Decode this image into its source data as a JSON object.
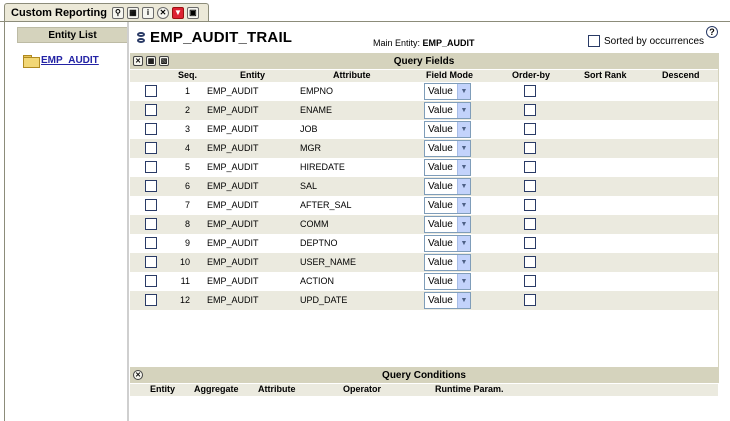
{
  "tab": {
    "title": "Custom Reporting",
    "buttons": [
      "search-icon",
      "save-icon",
      "info-icon",
      "close-icon",
      "down-arrow-icon",
      "window-icon"
    ]
  },
  "left_panel": {
    "header": "Entity List",
    "items": [
      {
        "label": "EMP_AUDIT"
      }
    ]
  },
  "header": {
    "title": "EMP_AUDIT_TRAIL",
    "main_entity_label": "Main Entity:",
    "main_entity_value": "EMP_AUDIT",
    "sorted_label": "Sorted by occurrences",
    "help_glyph": "?"
  },
  "query_fields": {
    "title": "Query Fields",
    "columns": {
      "seq": "Seq.",
      "entity": "Entity",
      "attribute": "Attribute",
      "field_mode": "Field Mode",
      "order_by": "Order-by",
      "sort_rank": "Sort Rank",
      "descend": "Descend"
    },
    "rows": [
      {
        "seq": "1",
        "entity": "EMP_AUDIT",
        "attribute": "EMPNO",
        "mode": "Value"
      },
      {
        "seq": "2",
        "entity": "EMP_AUDIT",
        "attribute": "ENAME",
        "mode": "Value"
      },
      {
        "seq": "3",
        "entity": "EMP_AUDIT",
        "attribute": "JOB",
        "mode": "Value"
      },
      {
        "seq": "4",
        "entity": "EMP_AUDIT",
        "attribute": "MGR",
        "mode": "Value"
      },
      {
        "seq": "5",
        "entity": "EMP_AUDIT",
        "attribute": "HIREDATE",
        "mode": "Value"
      },
      {
        "seq": "6",
        "entity": "EMP_AUDIT",
        "attribute": "SAL",
        "mode": "Value"
      },
      {
        "seq": "7",
        "entity": "EMP_AUDIT",
        "attribute": "AFTER_SAL",
        "mode": "Value"
      },
      {
        "seq": "8",
        "entity": "EMP_AUDIT",
        "attribute": "COMM",
        "mode": "Value"
      },
      {
        "seq": "9",
        "entity": "EMP_AUDIT",
        "attribute": "DEPTNO",
        "mode": "Value"
      },
      {
        "seq": "10",
        "entity": "EMP_AUDIT",
        "attribute": "USER_NAME",
        "mode": "Value"
      },
      {
        "seq": "11",
        "entity": "EMP_AUDIT",
        "attribute": "ACTION",
        "mode": "Value"
      },
      {
        "seq": "12",
        "entity": "EMP_AUDIT",
        "attribute": "UPD_DATE",
        "mode": "Value"
      }
    ]
  },
  "query_conditions": {
    "title": "Query Conditions",
    "columns": {
      "entity": "Entity",
      "aggregate": "Aggregate",
      "attribute": "Attribute",
      "operator": "Operator",
      "runtime_param": "Runtime Param."
    }
  },
  "colors": {
    "section_bar": "#d5d3bd",
    "row_shade": "#ebeadf",
    "link": "#2323a5"
  }
}
